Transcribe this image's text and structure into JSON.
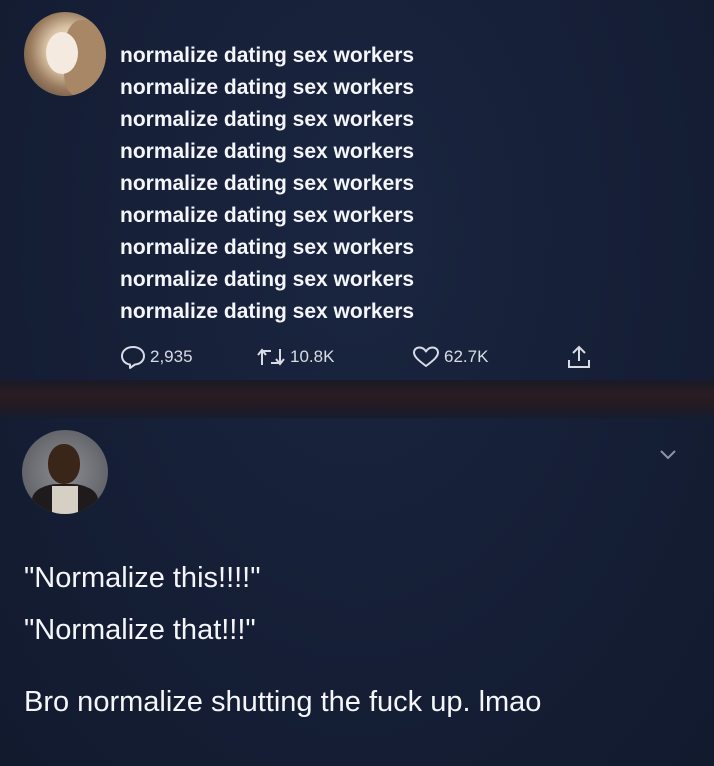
{
  "top_tweet": {
    "lines": [
      "normalize dating sex workers",
      "normalize dating sex workers",
      "normalize dating sex workers",
      "normalize dating sex workers",
      "normalize dating sex workers",
      "normalize dating sex workers",
      "normalize dating sex workers",
      "normalize dating sex workers",
      "normalize dating sex workers"
    ],
    "actions": {
      "replies": "2,935",
      "retweets": "10.8K",
      "likes": "62.7K"
    }
  },
  "reply_tweet": {
    "line1": "\"Normalize this!!!!\"",
    "line2": "\"Normalize that!!!\"",
    "line3": "Bro normalize shutting the fuck up. lmao"
  },
  "colors": {
    "background": "#15203a",
    "text": "#f5f6fa",
    "icon": "#d8dce6"
  },
  "icons": [
    "reply-icon",
    "retweet-icon",
    "like-icon",
    "share-icon",
    "chevron-down-icon"
  ]
}
